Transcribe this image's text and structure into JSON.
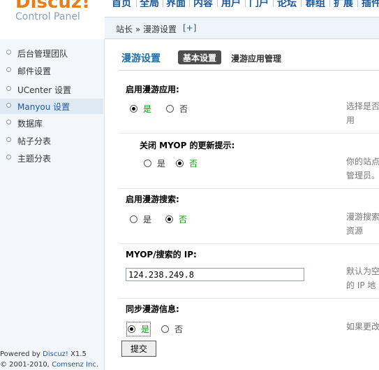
{
  "brand": {
    "logo": "Discuz!",
    "subtitle": "Control Panel"
  },
  "topnav": [
    "首页",
    "全局",
    "界面",
    "内容",
    "用户",
    "门户",
    "论坛",
    "群组",
    "扩展",
    "插件"
  ],
  "breadcrumb": {
    "text": "站长 » 漫游设置",
    "add": "[+]"
  },
  "sidebar": {
    "items": [
      {
        "label": "后台管理团队",
        "active": false
      },
      {
        "label": "邮件设置",
        "active": false
      },
      {
        "label": "UCenter 设置",
        "active": false
      },
      {
        "label": "Manyou 设置",
        "active": true
      },
      {
        "label": "数据库",
        "active": false
      },
      {
        "label": "帖子分表",
        "active": false
      },
      {
        "label": "主题分表",
        "active": false
      }
    ],
    "footer_powered": "Powered by",
    "footer_brand": "Discuz!",
    "footer_version": "X1.5",
    "footer_copy": "© 2001-2010,",
    "footer_company": "Comsenz Inc."
  },
  "main": {
    "title": "漫游设置",
    "tabs": [
      {
        "label": "基本设置",
        "active": true
      },
      {
        "label": "漫游应用管理",
        "active": false
      }
    ],
    "settings": [
      {
        "label": "启用漫游应用:",
        "yes": "是",
        "no": "否",
        "selected": "yes",
        "desc1": "选择是否",
        "desc2": "用"
      },
      {
        "label": "关闭 MYOP 的更新提示:",
        "yes": "是",
        "no": "否",
        "selected": "no",
        "desc1": "你的站点",
        "desc2": "管理员。"
      },
      {
        "label": "启用漫游搜索:",
        "yes": "是",
        "no": "否",
        "selected": "no",
        "desc1": "漫游搜索",
        "desc2": "资源"
      },
      {
        "label": "MYOP/搜索的 IP:",
        "value": "124.238.249.8",
        "desc1": "默认为空",
        "desc2": "的 IP 地"
      },
      {
        "label": "同步漫游信息:",
        "yes": "是",
        "no": "否",
        "selected": "yes",
        "desc1": "如果更改"
      }
    ],
    "submit": "提交"
  }
}
